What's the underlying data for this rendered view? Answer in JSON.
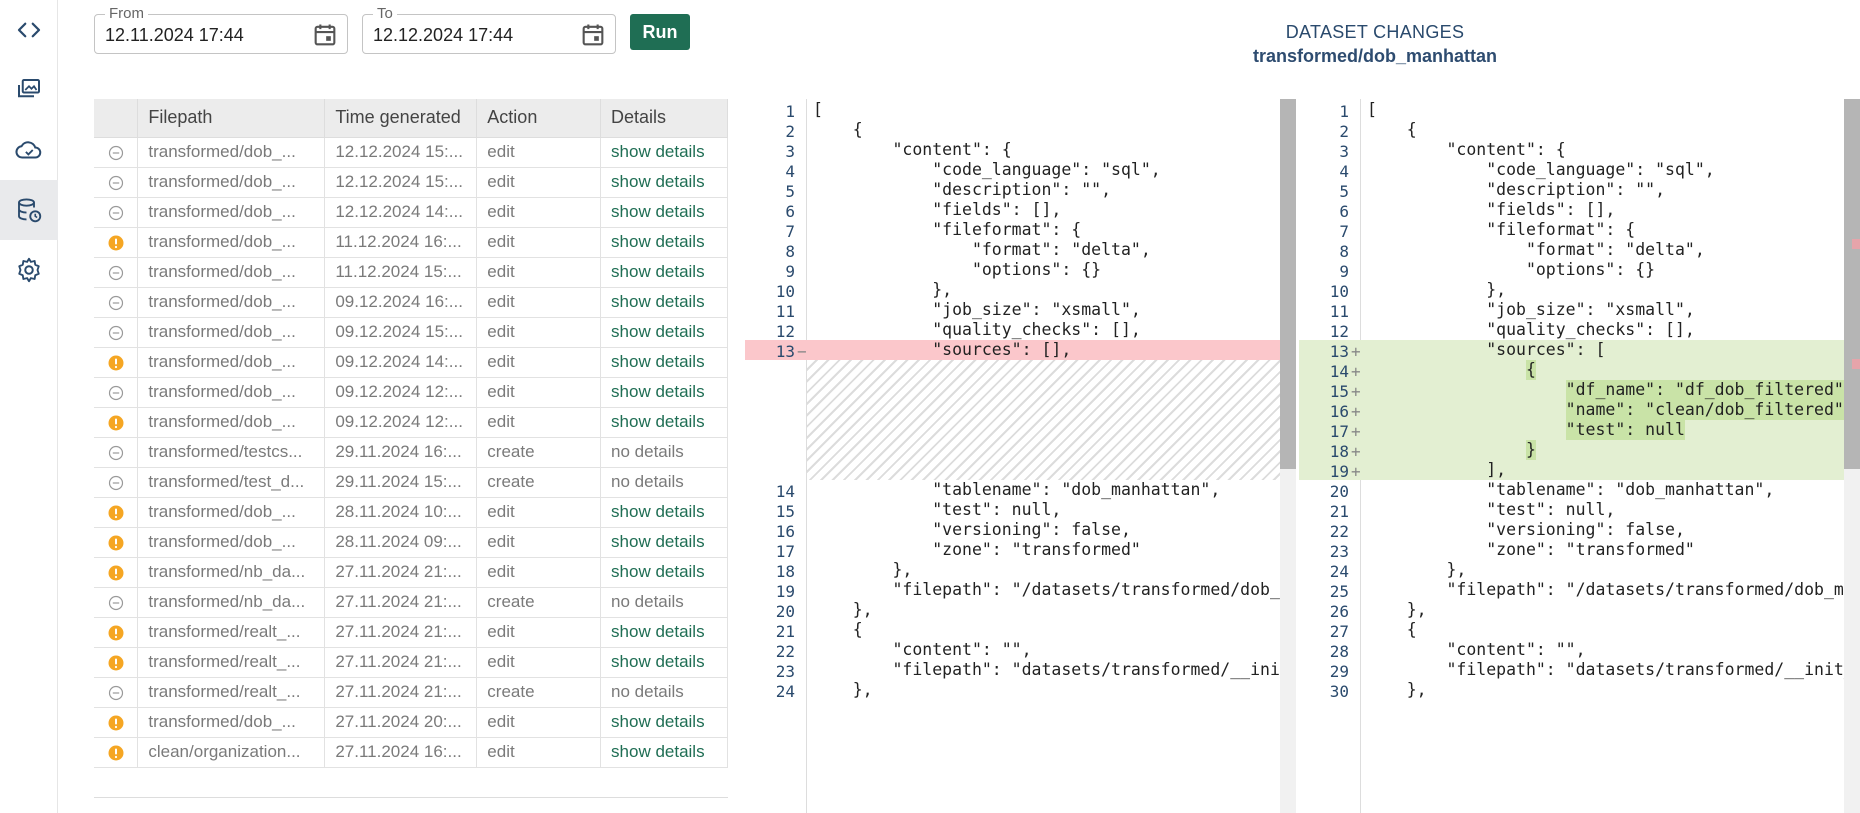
{
  "rail": [
    {
      "name": "code-icon",
      "active": false
    },
    {
      "name": "gallery-icon",
      "active": false
    },
    {
      "name": "cloud-sync-icon",
      "active": false
    },
    {
      "name": "database-history-icon",
      "active": true
    },
    {
      "name": "gear-icon",
      "active": false
    }
  ],
  "filters": {
    "from_label": "From",
    "from_value": "12.11.2024 17:44",
    "to_label": "To",
    "to_value": "12.12.2024 17:44",
    "run_label": "Run"
  },
  "title": {
    "line1": "DATASET CHANGES",
    "line2": "transformed/dob_manhattan"
  },
  "colors": {
    "accent": "#1f6e54",
    "warning": "#f5a623",
    "deleted": "#fbc7cb",
    "added": "#e3efd2",
    "added_highlight": "#c9e3a7"
  },
  "table": {
    "headers": [
      "",
      "Filepath",
      "Time generated",
      "Action",
      "Details"
    ],
    "rows": [
      {
        "status": "neutral",
        "filepath": "transformed/dob_...",
        "time": "12.12.2024 15:...",
        "action": "edit",
        "details": "show details",
        "has_details": true
      },
      {
        "status": "neutral",
        "filepath": "transformed/dob_...",
        "time": "12.12.2024 15:...",
        "action": "edit",
        "details": "show details",
        "has_details": true
      },
      {
        "status": "neutral",
        "filepath": "transformed/dob_...",
        "time": "12.12.2024 14:...",
        "action": "edit",
        "details": "show details",
        "has_details": true
      },
      {
        "status": "warning",
        "filepath": "transformed/dob_...",
        "time": "11.12.2024 16:...",
        "action": "edit",
        "details": "show details",
        "has_details": true
      },
      {
        "status": "neutral",
        "filepath": "transformed/dob_...",
        "time": "11.12.2024 15:...",
        "action": "edit",
        "details": "show details",
        "has_details": true
      },
      {
        "status": "neutral",
        "filepath": "transformed/dob_...",
        "time": "09.12.2024 16:...",
        "action": "edit",
        "details": "show details",
        "has_details": true
      },
      {
        "status": "neutral",
        "filepath": "transformed/dob_...",
        "time": "09.12.2024 15:...",
        "action": "edit",
        "details": "show details",
        "has_details": true
      },
      {
        "status": "warning",
        "filepath": "transformed/dob_...",
        "time": "09.12.2024 14:...",
        "action": "edit",
        "details": "show details",
        "has_details": true
      },
      {
        "status": "neutral",
        "filepath": "transformed/dob_...",
        "time": "09.12.2024 12:...",
        "action": "edit",
        "details": "show details",
        "has_details": true
      },
      {
        "status": "warning",
        "filepath": "transformed/dob_...",
        "time": "09.12.2024 12:...",
        "action": "edit",
        "details": "show details",
        "has_details": true
      },
      {
        "status": "neutral",
        "filepath": "transformed/testcs...",
        "time": "29.11.2024 16:...",
        "action": "create",
        "details": "no details",
        "has_details": false
      },
      {
        "status": "neutral",
        "filepath": "transformed/test_d...",
        "time": "29.11.2024 15:...",
        "action": "create",
        "details": "no details",
        "has_details": false
      },
      {
        "status": "warning",
        "filepath": "transformed/dob_...",
        "time": "28.11.2024 10:...",
        "action": "edit",
        "details": "show details",
        "has_details": true
      },
      {
        "status": "warning",
        "filepath": "transformed/dob_...",
        "time": "28.11.2024 09:...",
        "action": "edit",
        "details": "show details",
        "has_details": true
      },
      {
        "status": "warning",
        "filepath": "transformed/nb_da...",
        "time": "27.11.2024 21:...",
        "action": "edit",
        "details": "show details",
        "has_details": true
      },
      {
        "status": "neutral",
        "filepath": "transformed/nb_da...",
        "time": "27.11.2024 21:...",
        "action": "create",
        "details": "no details",
        "has_details": false
      },
      {
        "status": "warning",
        "filepath": "transformed/realt_...",
        "time": "27.11.2024 21:...",
        "action": "edit",
        "details": "show details",
        "has_details": true
      },
      {
        "status": "warning",
        "filepath": "transformed/realt_...",
        "time": "27.11.2024 21:...",
        "action": "edit",
        "details": "show details",
        "has_details": true
      },
      {
        "status": "neutral",
        "filepath": "transformed/realt_...",
        "time": "27.11.2024 21:...",
        "action": "create",
        "details": "no details",
        "has_details": false
      },
      {
        "status": "warning",
        "filepath": "transformed/dob_...",
        "time": "27.11.2024 20:...",
        "action": "edit",
        "details": "show details",
        "has_details": true
      },
      {
        "status": "warning",
        "filepath": "clean/organization...",
        "time": "27.11.2024 16:...",
        "action": "edit",
        "details": "show details",
        "has_details": true
      }
    ]
  },
  "diff": {
    "left": [
      {
        "n": "1",
        "text": "[",
        "type": "ctx"
      },
      {
        "n": "2",
        "text": "    {",
        "type": "ctx"
      },
      {
        "n": "3",
        "text": "        \"content\": {",
        "type": "ctx"
      },
      {
        "n": "4",
        "text": "            \"code_language\": \"sql\",",
        "type": "ctx"
      },
      {
        "n": "5",
        "text": "            \"description\": \"\",",
        "type": "ctx"
      },
      {
        "n": "6",
        "text": "            \"fields\": [],",
        "type": "ctx"
      },
      {
        "n": "7",
        "text": "            \"fileformat\": {",
        "type": "ctx"
      },
      {
        "n": "8",
        "text": "                \"format\": \"delta\",",
        "type": "ctx"
      },
      {
        "n": "9",
        "text": "                \"options\": {}",
        "type": "ctx"
      },
      {
        "n": "10",
        "text": "            },",
        "type": "ctx"
      },
      {
        "n": "11",
        "text": "            \"job_size\": \"xsmall\",",
        "type": "ctx"
      },
      {
        "n": "12",
        "text": "            \"quality_checks\": [],",
        "type": "ctx"
      },
      {
        "n": "13",
        "text": "            \"sources\": [],",
        "type": "del"
      },
      {
        "n": "",
        "text": "",
        "type": "gap"
      },
      {
        "n": "",
        "text": "",
        "type": "gap"
      },
      {
        "n": "",
        "text": "",
        "type": "gap"
      },
      {
        "n": "",
        "text": "",
        "type": "gap"
      },
      {
        "n": "",
        "text": "",
        "type": "gap"
      },
      {
        "n": "",
        "text": "",
        "type": "gap"
      },
      {
        "n": "14",
        "text": "            \"tablename\": \"dob_manhattan\",",
        "type": "ctx"
      },
      {
        "n": "15",
        "text": "            \"test\": null,",
        "type": "ctx"
      },
      {
        "n": "16",
        "text": "            \"versioning\": false,",
        "type": "ctx"
      },
      {
        "n": "17",
        "text": "            \"zone\": \"transformed\"",
        "type": "ctx"
      },
      {
        "n": "18",
        "text": "        },",
        "type": "ctx"
      },
      {
        "n": "19",
        "text": "        \"filepath\": \"/datasets/transformed/dob_manha",
        "type": "ctx"
      },
      {
        "n": "20",
        "text": "    },",
        "type": "ctx"
      },
      {
        "n": "21",
        "text": "    {",
        "type": "ctx"
      },
      {
        "n": "22",
        "text": "        \"content\": \"\",",
        "type": "ctx"
      },
      {
        "n": "23",
        "text": "        \"filepath\": \"datasets/transformed/__init__.p",
        "type": "ctx"
      },
      {
        "n": "24",
        "text": "    },",
        "type": "ctx"
      }
    ],
    "right": [
      {
        "n": "1",
        "text": "[",
        "type": "ctx"
      },
      {
        "n": "2",
        "text": "    {",
        "type": "ctx"
      },
      {
        "n": "3",
        "text": "        \"content\": {",
        "type": "ctx"
      },
      {
        "n": "4",
        "text": "            \"code_language\": \"sql\",",
        "type": "ctx"
      },
      {
        "n": "5",
        "text": "            \"description\": \"\",",
        "type": "ctx"
      },
      {
        "n": "6",
        "text": "            \"fields\": [],",
        "type": "ctx"
      },
      {
        "n": "7",
        "text": "            \"fileformat\": {",
        "type": "ctx"
      },
      {
        "n": "8",
        "text": "                \"format\": \"delta\",",
        "type": "ctx"
      },
      {
        "n": "9",
        "text": "                \"options\": {}",
        "type": "ctx"
      },
      {
        "n": "10",
        "text": "            },",
        "type": "ctx"
      },
      {
        "n": "11",
        "text": "            \"job_size\": \"xsmall\",",
        "type": "ctx"
      },
      {
        "n": "12",
        "text": "            \"quality_checks\": [],",
        "type": "ctx"
      },
      {
        "n": "13",
        "text": "            \"sources\": [",
        "type": "add"
      },
      {
        "n": "14",
        "text": "                {",
        "type": "add"
      },
      {
        "n": "15",
        "text": "                    \"df_name\": \"df_dob_filtered\",",
        "type": "add"
      },
      {
        "n": "16",
        "text": "                    \"name\": \"clean/dob_filtered\",",
        "type": "add"
      },
      {
        "n": "17",
        "text": "                    \"test\": null",
        "type": "add"
      },
      {
        "n": "18",
        "text": "                }",
        "type": "add"
      },
      {
        "n": "19",
        "text": "            ],",
        "type": "add"
      },
      {
        "n": "20",
        "text": "            \"tablename\": \"dob_manhattan\",",
        "type": "ctx"
      },
      {
        "n": "21",
        "text": "            \"test\": null,",
        "type": "ctx"
      },
      {
        "n": "22",
        "text": "            \"versioning\": false,",
        "type": "ctx"
      },
      {
        "n": "23",
        "text": "            \"zone\": \"transformed\"",
        "type": "ctx"
      },
      {
        "n": "24",
        "text": "        },",
        "type": "ctx"
      },
      {
        "n": "25",
        "text": "        \"filepath\": \"/datasets/transformed/dob_manha",
        "type": "ctx"
      },
      {
        "n": "26",
        "text": "    },",
        "type": "ctx"
      },
      {
        "n": "27",
        "text": "    {",
        "type": "ctx"
      },
      {
        "n": "28",
        "text": "        \"content\": \"\",",
        "type": "ctx"
      },
      {
        "n": "29",
        "text": "        \"filepath\": \"datasets/transformed/__init__.p",
        "type": "ctx"
      },
      {
        "n": "30",
        "text": "    },",
        "type": "ctx"
      }
    ]
  }
}
